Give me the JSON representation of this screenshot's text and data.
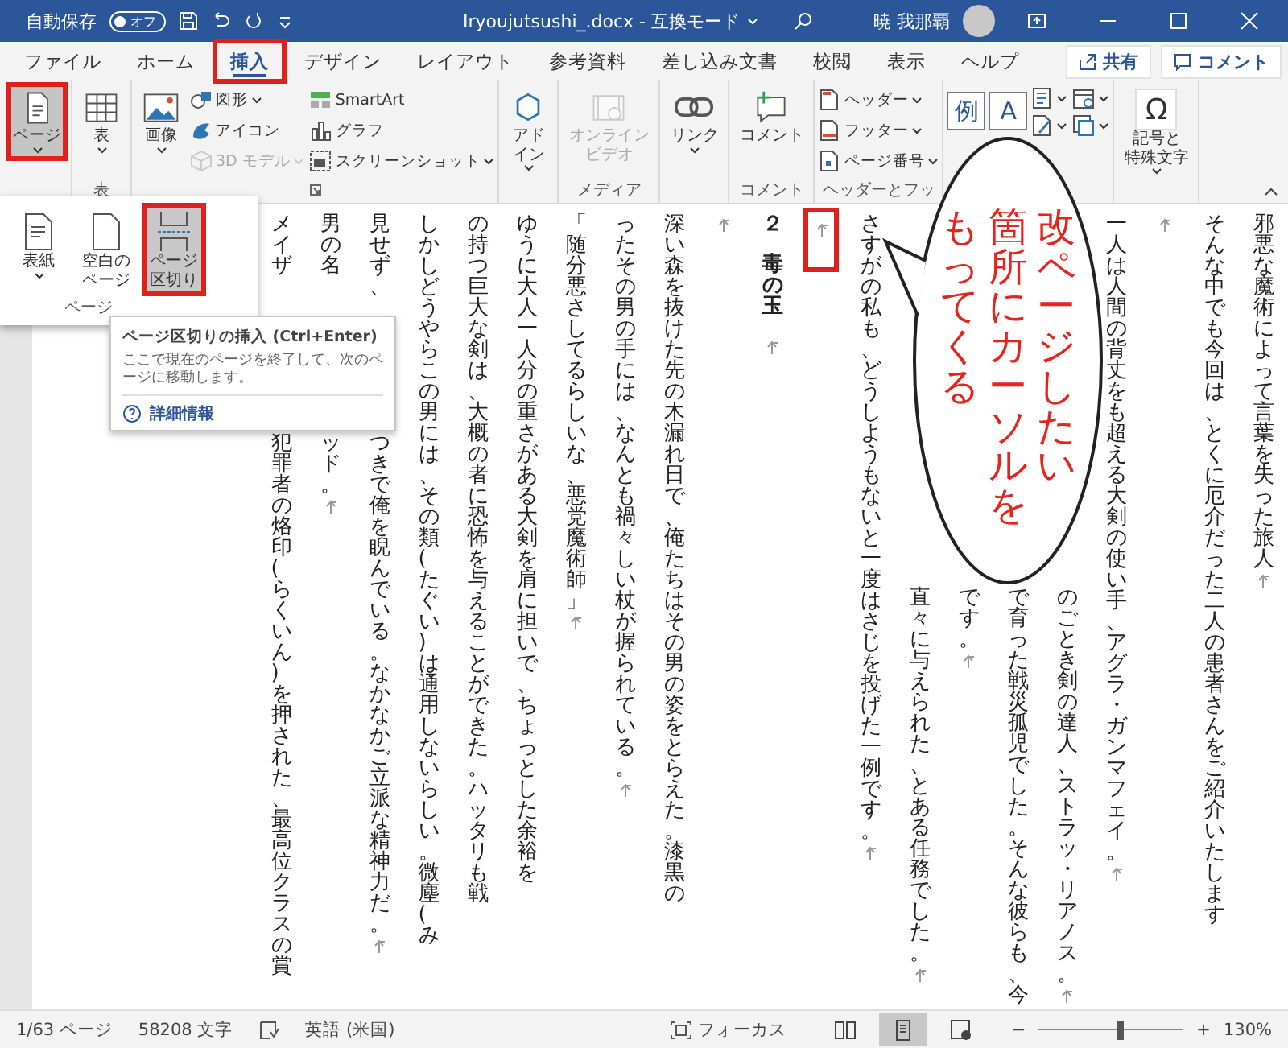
{
  "title_bar": {
    "autosave_label": "自動保存",
    "autosave": {
      "label": "オフ",
      "on": false
    },
    "document_title": "Iryoujutsushi_.docx  -  互換モード",
    "user_name": "暁 我那覇"
  },
  "tabs": [
    {
      "label": "ファイル",
      "selected": false,
      "annotated": false
    },
    {
      "label": "ホーム",
      "selected": false,
      "annotated": false
    },
    {
      "label": "挿入",
      "selected": true,
      "annotated": true
    },
    {
      "label": "デザイン",
      "selected": false,
      "annotated": false
    },
    {
      "label": "レイアウト",
      "selected": false,
      "annotated": false
    },
    {
      "label": "参考資料",
      "selected": false,
      "annotated": false
    },
    {
      "label": "差し込み文書",
      "selected": false,
      "annotated": false
    },
    {
      "label": "校閲",
      "selected": false,
      "annotated": false
    },
    {
      "label": "表示",
      "selected": false,
      "annotated": false
    },
    {
      "label": "ヘルプ",
      "selected": false,
      "annotated": false
    }
  ],
  "tab_actions": [
    "共有",
    "コメント"
  ],
  "ribbon": {
    "groups": [
      {
        "items": [
          {
            "kind": "large",
            "label": "ページ",
            "caret": true,
            "pressed": true,
            "annotated": true,
            "disabled": false
          }
        ]
      },
      {
        "label": "表",
        "items": [
          {
            "kind": "large",
            "label": "表",
            "caret": true,
            "pressed": false,
            "annotated": false,
            "disabled": false
          }
        ]
      },
      {
        "launcher": true,
        "items": [
          {
            "kind": "large",
            "label": "画像",
            "caret": true,
            "disabled": false
          },
          {
            "kind": "small",
            "label": "図形",
            "caret": true,
            "disabled": false
          },
          {
            "kind": "small",
            "label": "アイコン",
            "caret": false,
            "disabled": false
          },
          {
            "kind": "small",
            "label": "3D モデル",
            "caret": true,
            "disabled": true
          },
          {
            "kind": "small",
            "label": "SmartArt",
            "caret": false,
            "disabled": false
          },
          {
            "kind": "small",
            "label": "グラフ",
            "caret": false,
            "disabled": false
          },
          {
            "kind": "small",
            "label": "スクリーンショット",
            "caret": true,
            "disabled": false
          }
        ]
      },
      {
        "items": [
          {
            "kind": "large",
            "lines": [
              "アド",
              "イン"
            ],
            "caret": true,
            "disabled": false
          }
        ]
      },
      {
        "label": "メディア",
        "items": [
          {
            "kind": "large",
            "lines": [
              "オンライン",
              "ビデオ"
            ],
            "caret": false,
            "disabled": true
          }
        ]
      },
      {
        "items": [
          {
            "kind": "large",
            "label": "リンク",
            "caret": true,
            "disabled": false
          }
        ]
      },
      {
        "label": "コメント",
        "items": [
          {
            "kind": "large",
            "label": "コメント",
            "caret": false,
            "disabled": false
          }
        ]
      },
      {
        "label": "ヘッダーとフッ",
        "items": [
          {
            "kind": "small",
            "label": "ヘッダー",
            "caret": true,
            "disabled": false
          },
          {
            "kind": "small",
            "label": "フッター",
            "caret": true,
            "disabled": false
          },
          {
            "kind": "small",
            "label": "ページ番号",
            "caret": true,
            "disabled": false
          }
        ]
      },
      {
        "items": [
          {
            "kind": "glyph",
            "glyph": "例"
          },
          {
            "kind": "glyph",
            "glyph": "A"
          },
          {
            "kind": "icon",
            "caret": true
          },
          {
            "kind": "icon",
            "caret": true
          },
          {
            "kind": "icon",
            "caret": true
          },
          {
            "kind": "icon",
            "caret": true
          }
        ]
      },
      {
        "items": [
          {
            "kind": "large",
            "glyph": "Ω",
            "lines": [
              "記号と",
              "特殊文字"
            ],
            "caret": true,
            "disabled": false
          }
        ]
      }
    ]
  },
  "page_dropdown": {
    "items": [
      {
        "label": "表紙",
        "caret": true,
        "selected": false,
        "annotated": false
      },
      {
        "label": "空白のページ",
        "caret": false,
        "selected": false,
        "annotated": false
      },
      {
        "label": "ページ区切り",
        "caret": false,
        "selected": true,
        "annotated": true
      }
    ],
    "group_label": "ページ"
  },
  "tooltip": {
    "title": "ページ区切りの挿入 (Ctrl+Enter)",
    "description": "ここで現在のページを終了して、次のページに移動します。",
    "link": "詳細情報"
  },
  "document": {
    "columns": [
      {
        "kind": "line",
        "parts": [
          "メイザ",
          "犯罪者の烙印(らくいん)を押された、最高位クラスの賞"
        ],
        "covered_top": false,
        "return_mark": false
      },
      {
        "kind": "line",
        "parts": [
          "男の名",
          "ッド。"
        ],
        "covered_top": false,
        "return_mark": true
      },
      {
        "kind": "line",
        "parts": [
          "見せず、",
          "つきで俺を睨んでいる。なかなかご立派な精神力だ。"
        ],
        "covered_top": false,
        "return_mark": true
      },
      {
        "kind": "line",
        "parts": [
          "しかしどうやらこの男には、その類(たぐい)は通用しないらしい。微塵(み"
        ],
        "covered_top": false,
        "return_mark": false
      },
      {
        "kind": "line",
        "parts": [
          "の持つ巨大な剣は、大概の者に恐怖を与えることができた。ハッタリも戦"
        ],
        "covered_top": false,
        "return_mark": false
      },
      {
        "kind": "line",
        "parts": [
          "ゆうに大人一人分の重さがある大剣を肩に担いで、ちょっとした余裕を"
        ],
        "covered_top": false,
        "return_mark": false
      },
      {
        "kind": "line",
        "parts": [
          "「随分悪さしてるらしいな、悪党魔術師」"
        ],
        "covered_top": false,
        "return_mark": true
      },
      {
        "kind": "line",
        "parts": [
          "ったその男の手には、なんとも禍々しい杖が握られている。"
        ],
        "covered_top": false,
        "return_mark": true
      },
      {
        "kind": "line",
        "parts": [
          "深い森を抜けた先の木漏れ日で、俺たちはその男の姿をとらえた。漆黒の"
        ],
        "covered_top": false,
        "return_mark": false
      },
      {
        "kind": "empty",
        "return_mark": true,
        "annotated": false
      },
      {
        "kind": "heading",
        "parts": [
          "２",
          "毒の玉"
        ],
        "covered_top": false,
        "return_mark": true
      },
      {
        "kind": "empty",
        "return_mark": true,
        "annotated": true
      },
      {
        "kind": "line",
        "parts": [
          "さすがの私も、どうしようもないと一度はさじを投げた一例です。"
        ],
        "covered_top": false,
        "return_mark": true
      },
      {
        "kind": "line",
        "parts": [
          "直々に与えられた、とある任務でした。"
        ],
        "covered_top": true,
        "return_mark": true
      },
      {
        "kind": "line",
        "parts": [
          "です。"
        ],
        "covered_top": true,
        "return_mark": true
      },
      {
        "kind": "line",
        "parts": [
          "で育った戦災孤児でした。そんな彼らも、今"
        ],
        "covered_top": true,
        "return_mark": false
      },
      {
        "kind": "line",
        "parts": [
          "のごとき剣の達人、ストラッ・リアノス。"
        ],
        "covered_top": true,
        "return_mark": true
      },
      {
        "kind": "line",
        "parts": [
          "一人は人間の背丈をも超える大剣の使い手、アグラ・ガンマフェイ。"
        ],
        "covered_top": false,
        "return_mark": true
      },
      {
        "kind": "empty",
        "return_mark": true,
        "annotated": false
      },
      {
        "kind": "line",
        "parts": [
          "そんな中でも今回は、とくに厄介だった二人の患者さんをご紹介いたします"
        ],
        "covered_top": false,
        "return_mark": false
      },
      {
        "kind": "line",
        "parts": [
          "邪悪な魔術によって言葉を失った旅人"
        ],
        "covered_top": false,
        "return_mark": true
      }
    ],
    "callout": {
      "lines": [
        "もってくる",
        "箇所にカーソルを",
        "改ページしたい"
      ]
    }
  },
  "status_bar": {
    "page": "1/63 ページ",
    "words": "58208 文字",
    "language": "英語 (米国)",
    "focus": "フォーカス",
    "views": [
      {
        "selected": false
      },
      {
        "selected": true
      },
      {
        "selected": false
      }
    ],
    "zoom_out": "−",
    "zoom_in": "+",
    "zoom": {
      "level": 0.57,
      "label": "130%"
    }
  }
}
